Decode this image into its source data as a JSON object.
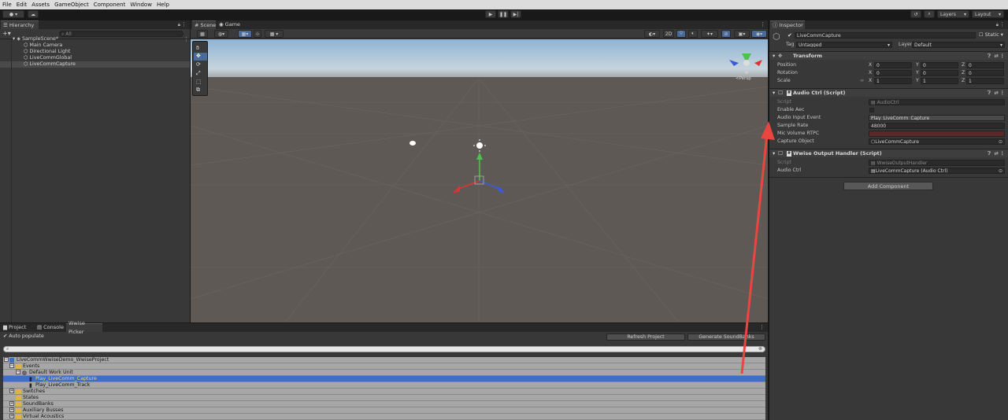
{
  "menu": [
    "File",
    "Edit",
    "Assets",
    "GameObject",
    "Component",
    "Window",
    "Help"
  ],
  "toolbar": {
    "layers": "Layers",
    "layout": "Layout"
  },
  "hierarchy": {
    "tab": "Hierarchy",
    "search_placeholder": "All",
    "scene": "SampleScene*",
    "items": [
      "Main Camera",
      "Directional Light",
      "LiveCommGlobal",
      "LiveCommCapture"
    ]
  },
  "scene": {
    "tabs": [
      "Scene",
      "Game"
    ],
    "mode_2d": "2D",
    "persp": "<Persp"
  },
  "inspector": {
    "tab": "Inspector",
    "object_name": "LiveCommCapture",
    "static": "Static",
    "tag_label": "Tag",
    "tag_value": "Untagged",
    "layer_label": "Layer",
    "layer_value": "Default",
    "transform": {
      "title": "Transform",
      "rows": [
        {
          "label": "Position",
          "x": "0",
          "y": "0",
          "z": "0"
        },
        {
          "label": "Rotation",
          "x": "0",
          "y": "0",
          "z": "0"
        },
        {
          "label": "Scale",
          "x": "1",
          "y": "1",
          "z": "1"
        }
      ]
    },
    "audio_ctrl": {
      "title": "Audio Ctrl (Script)",
      "script_label": "Script",
      "script_value": "AudioCtrl",
      "enable_aec": "Enable Aec",
      "audio_input_event": "Audio Input Event",
      "audio_input_event_value": "Play_LiveComm_Capture",
      "sample_rate": "Sample Rate",
      "sample_rate_value": "48000",
      "mic_volume": "Mic Volume RTPC",
      "capture_object": "Capture Object",
      "capture_object_value": "LiveCommCapture"
    },
    "output_handler": {
      "title": "Wwise Output Handler (Script)",
      "script_label": "Script",
      "script_value": "WwiseOutputHandler",
      "audio_ctrl_label": "Audio Ctrl",
      "audio_ctrl_value": "LiveCommCapture (Audio Ctrl)"
    },
    "add_component": "Add Component"
  },
  "bottom": {
    "tabs": [
      "Project",
      "Console",
      "Wwise Picker"
    ],
    "auto_populate": "Auto populate",
    "refresh": "Refresh Project",
    "generate": "Generate SoundBanks",
    "tree": [
      {
        "label": "LiveCommWwiseDemo_WwiseProject",
        "indent": 0,
        "type": "project"
      },
      {
        "label": "Events",
        "indent": 1,
        "type": "folder"
      },
      {
        "label": "Default Work Unit",
        "indent": 2,
        "type": "workunit"
      },
      {
        "label": "Play_LiveComm_Capture",
        "indent": 3,
        "type": "event",
        "selected": true
      },
      {
        "label": "Play_LiveComm_Track",
        "indent": 3,
        "type": "event"
      },
      {
        "label": "Switches",
        "indent": 1,
        "type": "folder"
      },
      {
        "label": "States",
        "indent": 1,
        "type": "folder"
      },
      {
        "label": "SoundBanks",
        "indent": 1,
        "type": "folder"
      },
      {
        "label": "Auxiliary Busses",
        "indent": 1,
        "type": "folder"
      },
      {
        "label": "Virtual Acoustics",
        "indent": 1,
        "type": "folder"
      }
    ]
  },
  "colors": {
    "accent": "#3d6fc4",
    "arrow": "#e8463f",
    "selected_text": "#ffd84a"
  }
}
